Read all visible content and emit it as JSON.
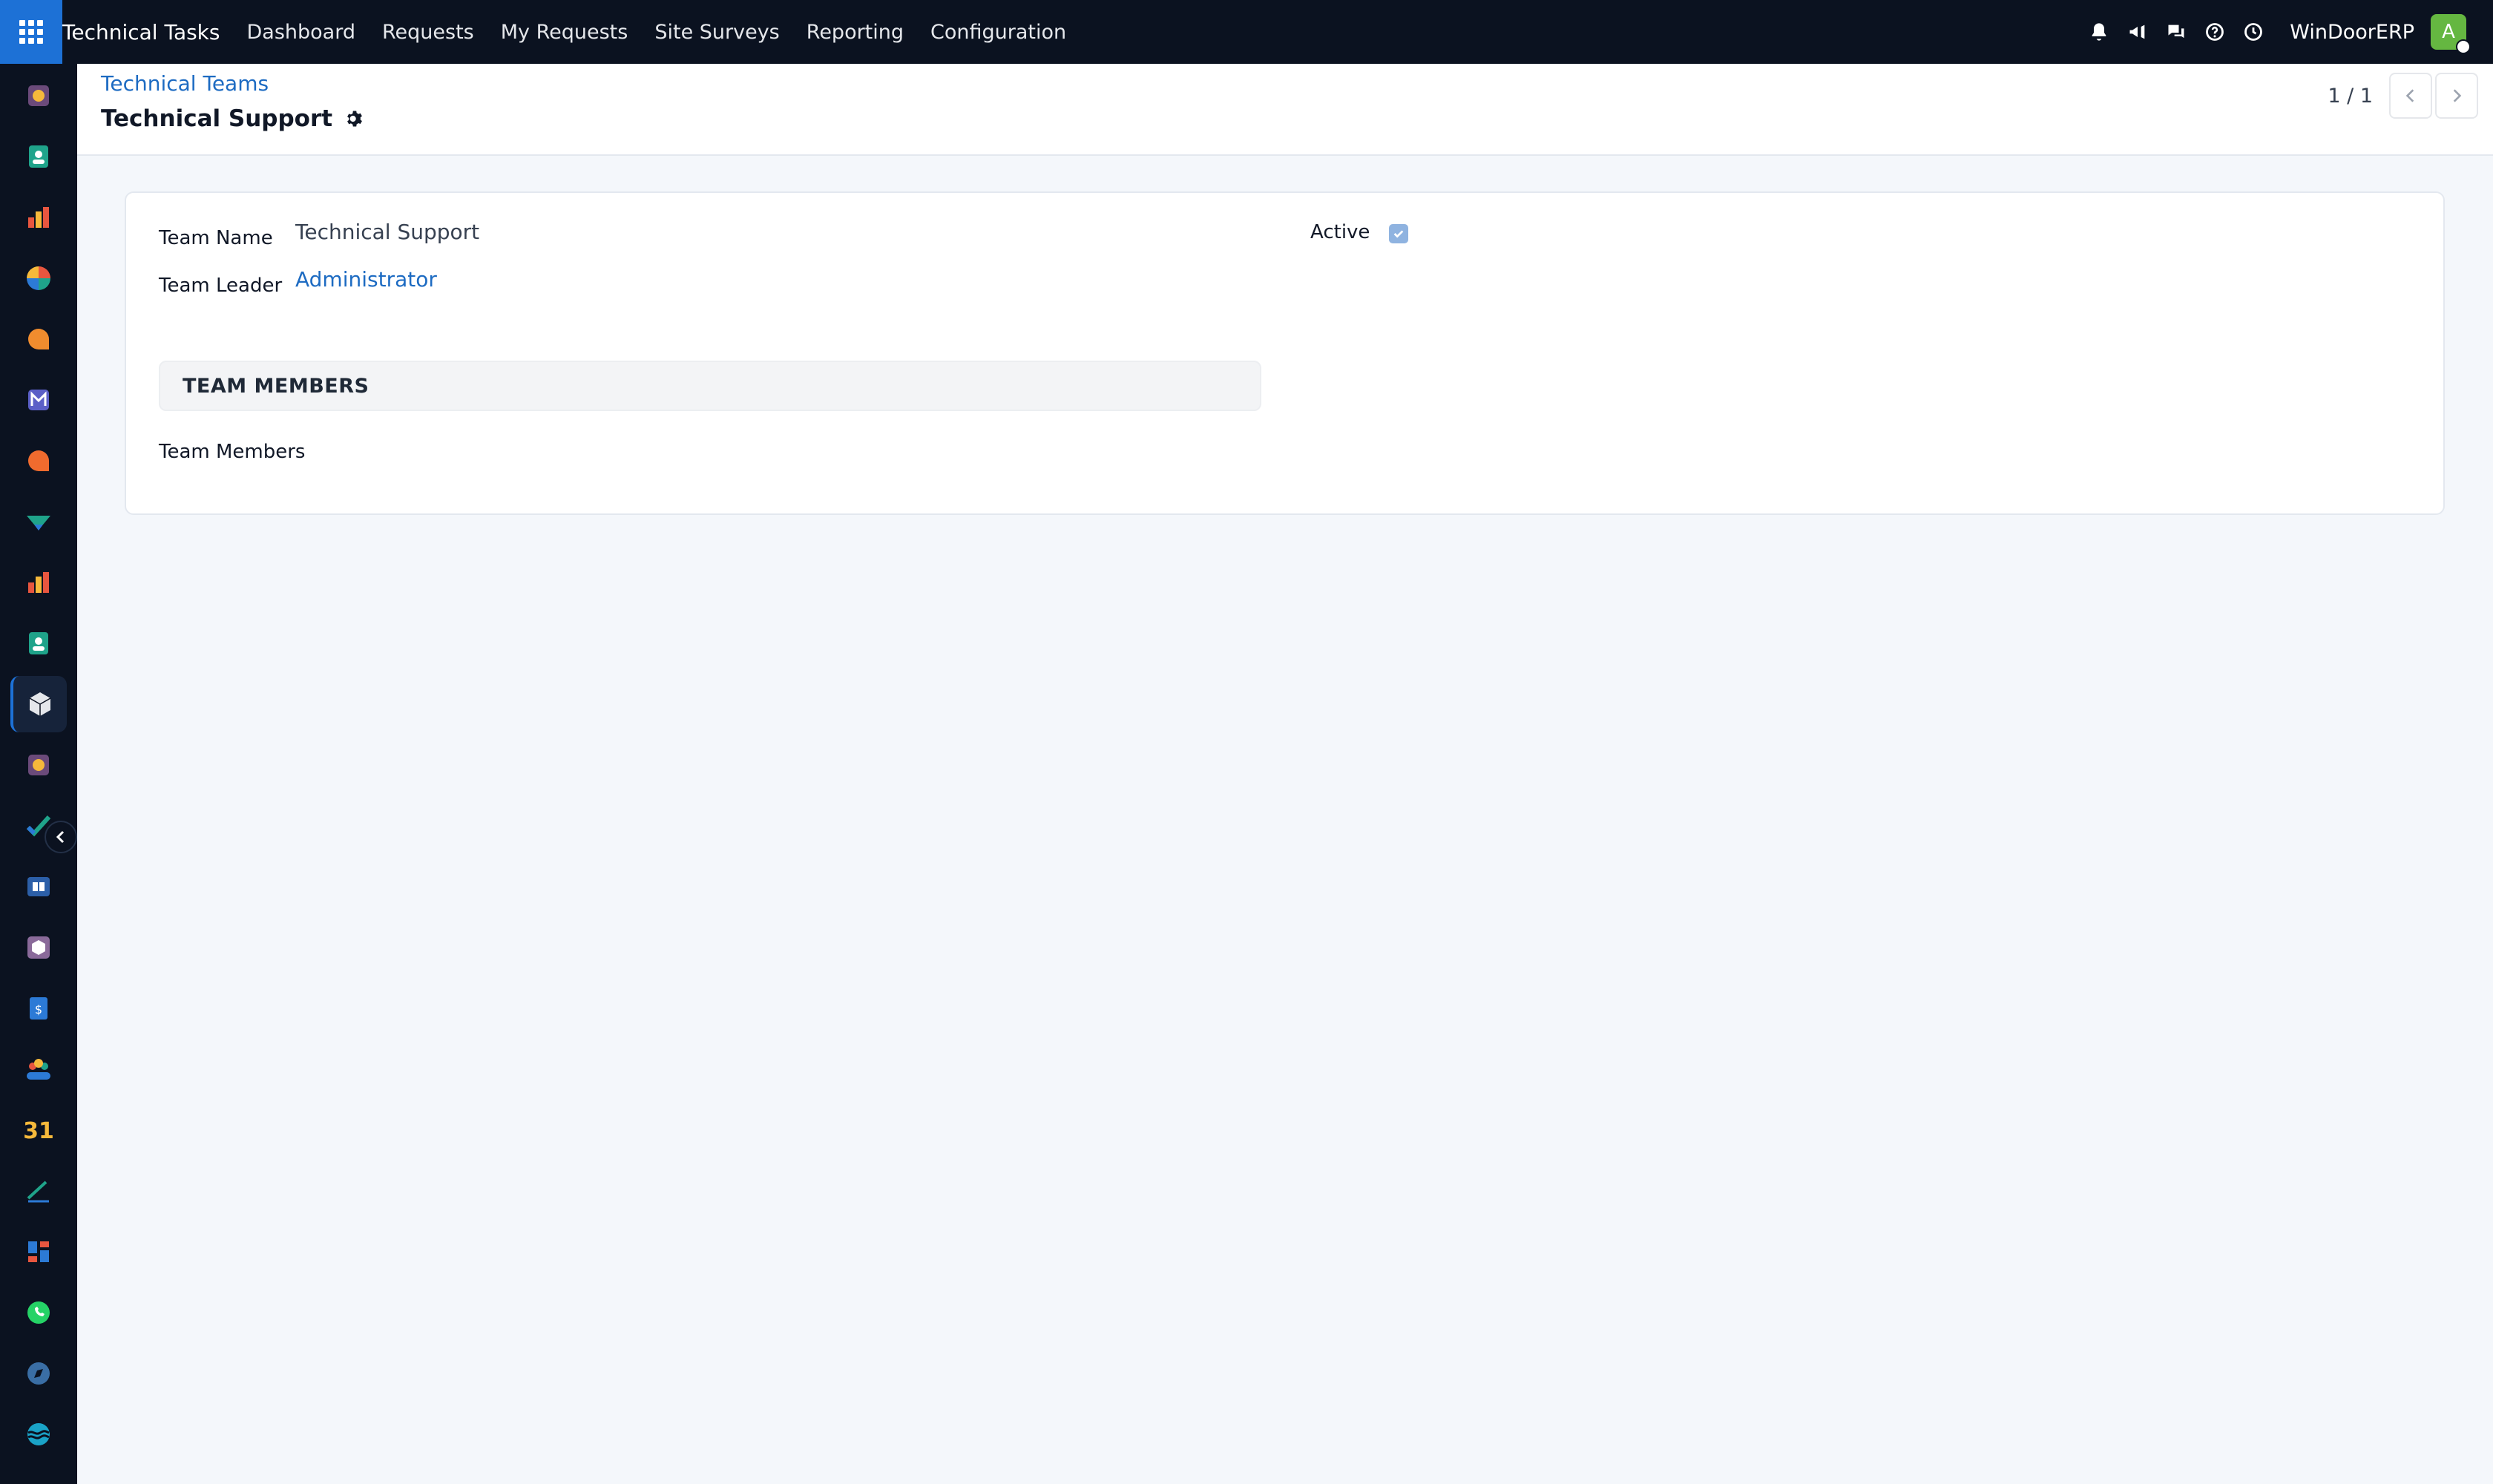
{
  "navbar": {
    "app_name": "Technical Tasks",
    "menu": [
      "Dashboard",
      "Requests",
      "My Requests",
      "Site Surveys",
      "Reporting",
      "Configuration"
    ],
    "company": "WinDoorERP",
    "avatar_initial": "A",
    "icons": [
      "bell-icon",
      "megaphone-icon",
      "chat-icon",
      "help-icon",
      "clock-icon"
    ]
  },
  "sidebar": {
    "items": [
      "app-icon-1",
      "contacts-icon",
      "bar-chart-icon",
      "pie-icon",
      "chat-bubble-icon",
      "mail-icon",
      "chat-bubble-icon-2",
      "check-flag-icon",
      "bar-chart-icon-2",
      "contacts-icon-2",
      "box-icon",
      "app-icon-2",
      "todo-icon",
      "book-icon",
      "package-icon",
      "invoice-icon",
      "people-icon",
      "calendar-icon",
      "sign-icon",
      "dashboard-icon",
      "whatsapp-icon",
      "compass-icon",
      "wave-icon"
    ],
    "active_index": 10,
    "calendar_label": "31"
  },
  "control": {
    "breadcrumb": "Technical Teams",
    "title": "Technical Support",
    "pager": "1 / 1"
  },
  "form": {
    "team_name_label": "Team Name",
    "team_name_value": "Technical Support",
    "team_leader_label": "Team Leader",
    "team_leader_value": "Administrator",
    "active_label": "Active",
    "active_checked": true,
    "section_title": "TEAM MEMBERS",
    "members_label": "Team Members"
  },
  "colors": {
    "navbar_bg": "#0b1220",
    "accent": "#1d71d6",
    "link": "#1d6bc2",
    "page_bg": "#f4f7fb"
  }
}
